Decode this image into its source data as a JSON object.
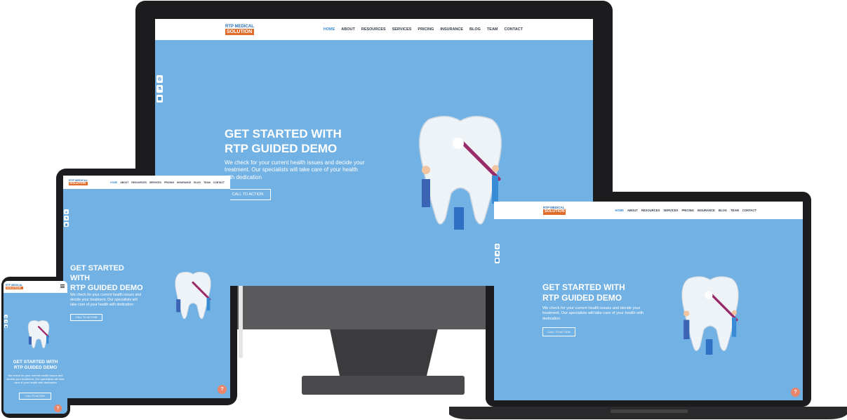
{
  "brand": {
    "logo_top": "RTP MEDICAL",
    "logo_bottom": "SOLUTION"
  },
  "nav": {
    "items": [
      "HOME",
      "ABOUT",
      "RESOURCES",
      "SERVICES",
      "PRICING",
      "INSURANCE",
      "BLOG",
      "TEAM",
      "CONTACT"
    ]
  },
  "hero": {
    "title_line1": "GET STARTED WITH",
    "title_line2": "RTP GUIDED DEMO",
    "tablet_title_line1": "GET STARTED",
    "tablet_title_line2": "WITH",
    "text": "We check for your current health issues and decide your treatment. Our specialists will take care of your health with dedication",
    "cta": "CALL TO ACTION",
    "help": "?"
  },
  "colors": {
    "hero_bg": "#72b1e3",
    "nav_active": "#3a8bd6",
    "logo_orange": "#e06c2c",
    "help": "#e8856a",
    "device_frame": "#1c1c1e"
  },
  "icons": [
    "globe-icon",
    "flask-icon",
    "calendar-icon"
  ]
}
